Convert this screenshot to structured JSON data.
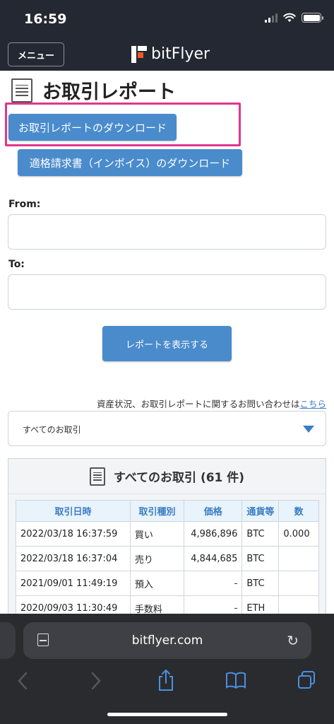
{
  "status_bar": {
    "time": "16:59"
  },
  "header": {
    "menu_label": "メニュー",
    "brand": "bitFlyer"
  },
  "page": {
    "title": "お取引レポート",
    "download_button": "お取引レポートのダウンロード",
    "invoice_button": "適格請求書（インボイス）のダウンロード",
    "from_label": "From:",
    "to_label": "To:",
    "show_button": "レポートを表示する",
    "contact_text": "資産状況、お取引レポートに関するお問い合わせは",
    "contact_link": "こちら",
    "filter_selected": "すべてのお取引"
  },
  "transactions": {
    "title": "すべてのお取引 (61 件)",
    "columns": [
      "取引日時",
      "取引種別",
      "価格",
      "通貨等",
      "数"
    ],
    "rows": [
      [
        "2022/03/18 16:37:59",
        "買い",
        "4,986,896",
        "BTC",
        "0.000"
      ],
      [
        "2022/03/18 16:37:04",
        "売り",
        "4,844,685",
        "BTC",
        ""
      ],
      [
        "2021/09/01 11:49:19",
        "預入",
        "-",
        "BTC",
        ""
      ],
      [
        "2020/09/03 11:30:49",
        "手数料",
        "-",
        "ETH",
        ""
      ]
    ]
  },
  "browser": {
    "url": "bitflyer.com"
  },
  "colors": {
    "accent": "#4a8bcc",
    "highlight": "#e0368c",
    "header_bg": "#242832",
    "browser_icon": "#4a90e2"
  }
}
